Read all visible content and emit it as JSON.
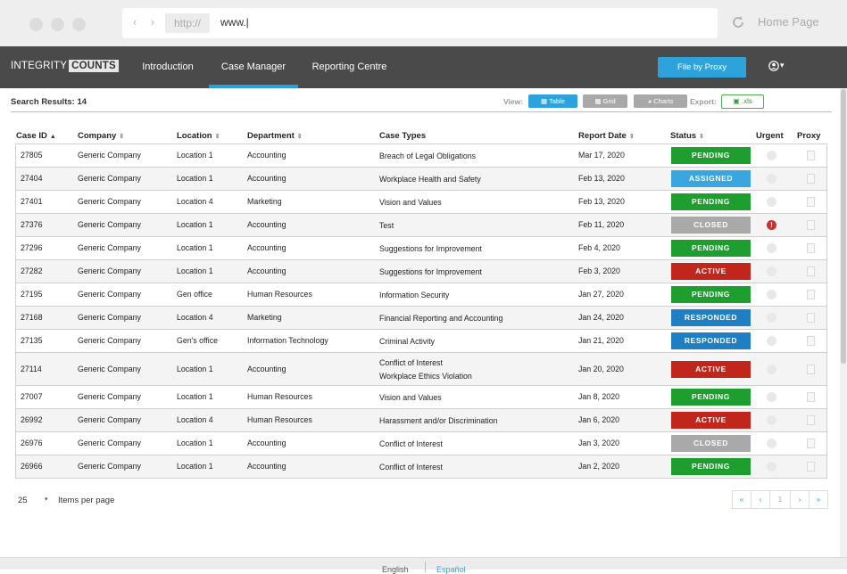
{
  "browser": {
    "nav_arrows": "‹ ›",
    "protocol": "http://",
    "url": "www.|",
    "home_label": "Home Page"
  },
  "app": {
    "logo_word1": "INTEGRITY",
    "logo_word2": "COUNTS",
    "nav": [
      "Introduction",
      "Case Manager",
      "Reporting Centre"
    ],
    "active_nav": "Case Manager",
    "proxy_button": "File by Proxy",
    "user_menu_caret": "▾"
  },
  "toolbar": {
    "results_label": "Search Results: 14",
    "view_label": "View:",
    "views": [
      "Table",
      "Grid",
      "Charts"
    ],
    "export_label": "Export:",
    "export_xls": ".xls"
  },
  "table": {
    "columns": [
      "Case ID",
      "Company",
      "Location",
      "Department",
      "Case Types",
      "Report Date",
      "Status",
      "Urgent",
      "Proxy"
    ],
    "sort_up": "▲",
    "sort_both": "⇕",
    "rows": [
      {
        "id": "27805",
        "company": "Generic Company",
        "location": "Location 1",
        "department": "Accounting",
        "types": [
          "Breach of Legal Obligations"
        ],
        "date": "Mar 17, 2020",
        "status": "PENDING",
        "urgent": false
      },
      {
        "id": "27404",
        "company": "Generic Company",
        "location": "Location 1",
        "department": "Accounting",
        "types": [
          "Workplace Health and Safety"
        ],
        "date": "Feb 13, 2020",
        "status": "ASSIGNED",
        "urgent": false
      },
      {
        "id": "27401",
        "company": "Generic Company",
        "location": "Location 4",
        "department": "Marketing",
        "types": [
          "Vision and Values"
        ],
        "date": "Feb 13, 2020",
        "status": "PENDING",
        "urgent": false
      },
      {
        "id": "27376",
        "company": "Generic Company",
        "location": "Location 1",
        "department": "Accounting",
        "types": [
          "Test"
        ],
        "date": "Feb 11, 2020",
        "status": "CLOSED",
        "urgent": true
      },
      {
        "id": "27296",
        "company": "Generic Company",
        "location": "Location 1",
        "department": "Accounting",
        "types": [
          "Suggestions for Improvement"
        ],
        "date": "Feb 4, 2020",
        "status": "PENDING",
        "urgent": false
      },
      {
        "id": "27282",
        "company": "Generic Company",
        "location": "Location 1",
        "department": "Accounting",
        "types": [
          "Suggestions for Improvement"
        ],
        "date": "Feb 3, 2020",
        "status": "ACTIVE",
        "urgent": false
      },
      {
        "id": "27195",
        "company": "Generic Company",
        "location": "Gen office",
        "department": "Human Resources",
        "types": [
          "Information Security"
        ],
        "date": "Jan 27, 2020",
        "status": "PENDING",
        "urgent": false
      },
      {
        "id": "27168",
        "company": "Generic Company",
        "location": "Location 4",
        "department": "Marketing",
        "types": [
          "Financial Reporting and Accounting"
        ],
        "date": "Jan 24, 2020",
        "status": "RESPONDED",
        "urgent": false
      },
      {
        "id": "27135",
        "company": "Generic Company",
        "location": "Gen's office",
        "department": "Information Technology",
        "types": [
          "Criminal Activity"
        ],
        "date": "Jan 21, 2020",
        "status": "RESPONDED",
        "urgent": false
      },
      {
        "id": "27114",
        "company": "Generic Company",
        "location": "Location 1",
        "department": "Accounting",
        "types": [
          "Conflict of Interest",
          "Workplace Ethics Violation"
        ],
        "date": "Jan 20, 2020",
        "status": "ACTIVE",
        "urgent": false
      },
      {
        "id": "27007",
        "company": "Generic Company",
        "location": "Location 1",
        "department": "Human Resources",
        "types": [
          "Vision and Values"
        ],
        "date": "Jan 8, 2020",
        "status": "PENDING",
        "urgent": false
      },
      {
        "id": "26992",
        "company": "Generic Company",
        "location": "Location 4",
        "department": "Human Resources",
        "types": [
          "Harassment and/or Discrimination"
        ],
        "date": "Jan 6, 2020",
        "status": "ACTIVE",
        "urgent": false
      },
      {
        "id": "26976",
        "company": "Generic Company",
        "location": "Location 1",
        "department": "Accounting",
        "types": [
          "Conflict of Interest"
        ],
        "date": "Jan 3, 2020",
        "status": "CLOSED",
        "urgent": false
      },
      {
        "id": "26966",
        "company": "Generic Company",
        "location": "Location 1",
        "department": "Accounting",
        "types": [
          "Conflict of Interest"
        ],
        "date": "Jan 2, 2020",
        "status": "PENDING",
        "urgent": false
      }
    ],
    "status_colors": {
      "PENDING": "#1e9e2e",
      "ASSIGNED": "#3aa6df",
      "CLOSED": "#a9a9a9",
      "ACTIVE": "#c0261b",
      "RESPONDED": "#1f7fc2"
    }
  },
  "pagination": {
    "per_page": "25",
    "per_page_caret": "▾",
    "per_page_label": "Items per page",
    "buttons": [
      "«",
      "‹",
      "1",
      "›",
      "»"
    ]
  },
  "footer": {
    "languages": [
      "English",
      "Español"
    ]
  }
}
